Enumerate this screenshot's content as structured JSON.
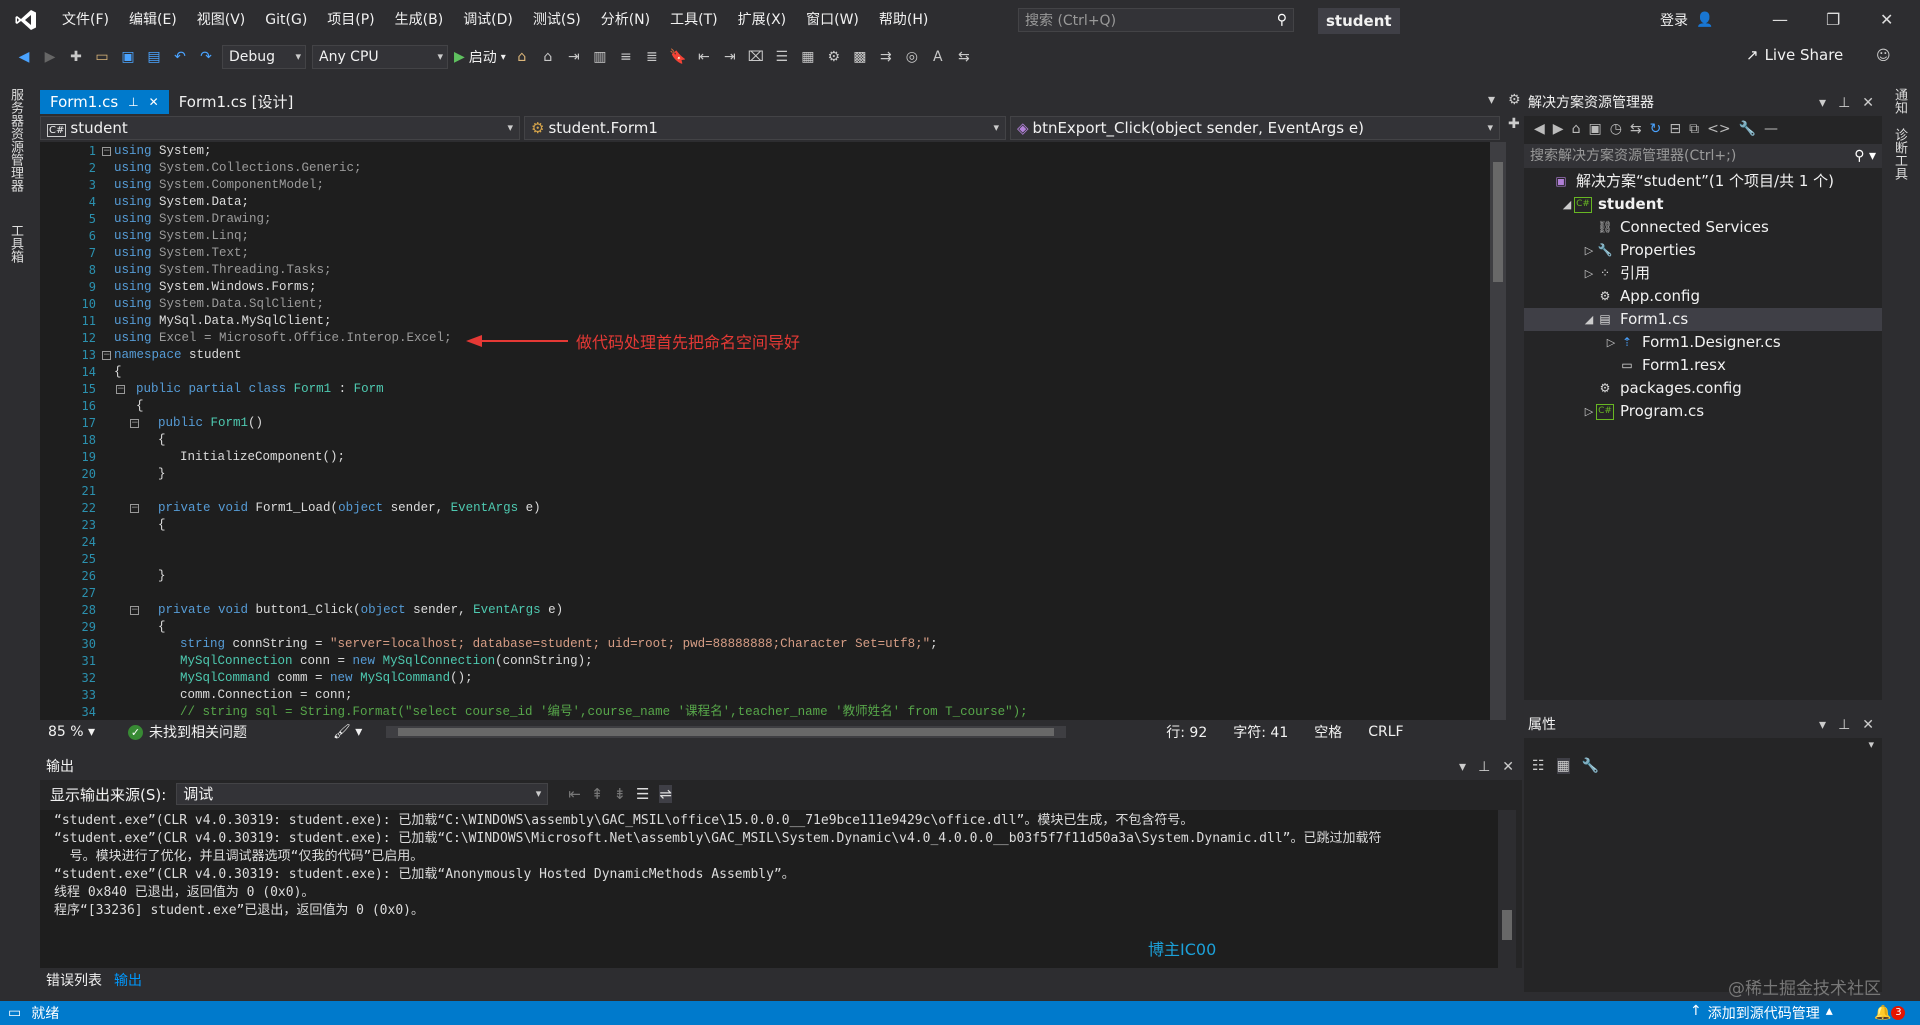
{
  "menu": [
    "文件(F)",
    "编辑(E)",
    "视图(V)",
    "Git(G)",
    "项目(P)",
    "生成(B)",
    "调试(D)",
    "测试(S)",
    "分析(N)",
    "工具(T)",
    "扩展(X)",
    "窗口(W)",
    "帮助(H)"
  ],
  "search_placeholder": "搜索 (Ctrl+Q)",
  "solution_badge": "student",
  "login": "登录",
  "toolbar": {
    "config": "Debug",
    "platform": "Any CPU",
    "start": "启动",
    "live_share": "Live Share"
  },
  "left_tabs": [
    "服务器资源管理器",
    "工具箱"
  ],
  "right_tabs": [
    "通知",
    "诊断工具"
  ],
  "editor": {
    "tabs": [
      "Form1.cs",
      "Form1.cs [设计]"
    ],
    "nav_project": "student",
    "nav_class": "student.Form1",
    "nav_member": "btnExport_Click(object sender, EventArgs e)",
    "annotation": "做代码处理首先把命名空间导好",
    "lines": [
      "using System;",
      "using System.Collections.Generic;",
      "using System.ComponentModel;",
      "using System.Data;",
      "using System.Drawing;",
      "using System.Linq;",
      "using System.Text;",
      "using System.Threading.Tasks;",
      "using System.Windows.Forms;",
      "using System.Data.SqlClient;",
      "using MySql.Data.MySqlClient;",
      "using Excel = Microsoft.Office.Interop.Excel;",
      "namespace student",
      "{",
      "public partial class Form1 : Form",
      "{",
      "public Form1()",
      "{",
      "InitializeComponent();",
      "}",
      "",
      "private void Form1_Load(object sender, EventArgs e)",
      "{",
      "",
      "",
      "}",
      "",
      "private void button1_Click(object sender, EventArgs e)",
      "{",
      "string connString = \"server=localhost; database=student; uid=root; pwd=88888888;Character Set=utf8;\";",
      "MySqlConnection conn = new MySqlConnection(connString);",
      "MySqlCommand comm = new MySqlCommand();",
      "comm.Connection = conn;",
      "// string sql = String.Format(\"select course_id '编号',course_name '课程名',teacher_name '教师姓名' from T_course\");"
    ]
  },
  "editor_status": {
    "zoom": "85 %",
    "issues": "未找到相关问题",
    "line": "行: 92",
    "col": "字符: 41",
    "whitespace": "空格",
    "eol": "CRLF"
  },
  "solution_explorer": {
    "title": "解决方案资源管理器",
    "search": "搜索解决方案资源管理器(Ctrl+;)",
    "items": [
      {
        "label": "解决方案“student”(1 个项目/共 1 个)",
        "indent": 0,
        "arrow": "",
        "icon": "solution-icon"
      },
      {
        "label": "student",
        "indent": 1,
        "arrow": "◢",
        "icon": "csharp-project-icon"
      },
      {
        "label": "Connected Services",
        "indent": 2,
        "arrow": "",
        "icon": "connected-services-icon"
      },
      {
        "label": "Properties",
        "indent": 2,
        "arrow": "▷",
        "icon": "wrench-icon"
      },
      {
        "label": "引用",
        "indent": 2,
        "arrow": "▷",
        "icon": "references-icon"
      },
      {
        "label": "App.config",
        "indent": 2,
        "arrow": "",
        "icon": "config-file-icon"
      },
      {
        "label": "Form1.cs",
        "indent": 2,
        "arrow": "◢",
        "icon": "form-icon"
      },
      {
        "label": "Form1.Designer.cs",
        "indent": 3,
        "arrow": "▷",
        "icon": "cs-file-icon"
      },
      {
        "label": "Form1.resx",
        "indent": 3,
        "arrow": "",
        "icon": "resx-file-icon"
      },
      {
        "label": "packages.config",
        "indent": 2,
        "arrow": "",
        "icon": "config-file-icon"
      },
      {
        "label": "Program.cs",
        "indent": 2,
        "arrow": "▷",
        "icon": "cs-class-icon"
      }
    ]
  },
  "properties": {
    "title": "属性"
  },
  "output": {
    "title": "输出",
    "source_label": "显示输出来源(S):",
    "source_value": "调试",
    "lines": [
      "“student.exe”(CLR v4.0.30319: student.exe): 已加载“C:\\WINDOWS\\assembly\\GAC_MSIL\\office\\15.0.0.0__71e9bce111e9429c\\office.dll”。模块已生成，不包含符号。",
      "“student.exe”(CLR v4.0.30319: student.exe): 已加载“C:\\WINDOWS\\Microsoft.Net\\assembly\\GAC_MSIL\\System.Dynamic\\v4.0_4.0.0.0__b03f5f7f11d50a3a\\System.Dynamic.dll”。已跳过加载符",
      "  号。模块进行了优化，并且调试器选项“仅我的代码”已启用。",
      "“student.exe”(CLR v4.0.30319: student.exe): 已加载“Anonymously Hosted DynamicMethods Assembly”。",
      "线程 0x840 已退出，返回值为 0 (0x0)。",
      "程序“[33236] student.exe”已退出，返回值为 0 (0x0)。"
    ]
  },
  "watermark_blogger": "博主IC00",
  "watermark_site": "@稀土掘金技术社区",
  "bottom_tabs": [
    "错误列表",
    "输出"
  ],
  "statusbar": {
    "ready": "就绪",
    "source_control": "添加到源代码管理",
    "notifications": "3"
  },
  "colors": {
    "accent": "#007acc",
    "annotation": "#e53935"
  }
}
